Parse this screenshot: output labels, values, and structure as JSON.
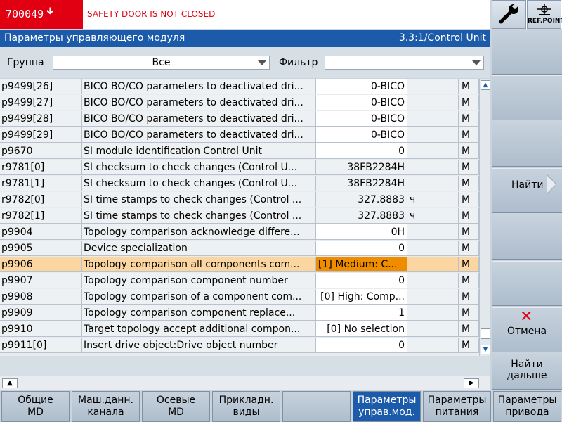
{
  "alarm": {
    "code": "700049",
    "message": "SAFETY DOOR IS NOT CLOSED"
  },
  "title": {
    "left": "Параметры управляющего модуля",
    "right": "3.3:1/Control Unit"
  },
  "filter": {
    "group_label": "Группа",
    "group_value": "Все",
    "filter_label": "Фильтр",
    "filter_value": ""
  },
  "rows": [
    {
      "param": "p9499[26]",
      "desc": "BICO BO/CO parameters to deactivated dri...",
      "value": "0-BICO",
      "unit": "",
      "mode": "M"
    },
    {
      "param": "p9499[27]",
      "desc": "BICO BO/CO parameters to deactivated dri...",
      "value": "0-BICO",
      "unit": "",
      "mode": "M"
    },
    {
      "param": "p9499[28]",
      "desc": "BICO BO/CO parameters to deactivated dri...",
      "value": "0-BICO",
      "unit": "",
      "mode": "M"
    },
    {
      "param": "p9499[29]",
      "desc": "BICO BO/CO parameters to deactivated dri...",
      "value": "0-BICO",
      "unit": "",
      "mode": "M"
    },
    {
      "param": "p9670",
      "desc": "SI module identification Control Unit",
      "value": "0",
      "unit": "",
      "mode": "M"
    },
    {
      "param": "r9781[0]",
      "desc": "SI checksum to check changes (Control U...",
      "value": "38FB2284H",
      "unit": "",
      "mode": "M"
    },
    {
      "param": "r9781[1]",
      "desc": "SI checksum to check changes (Control U...",
      "value": "38FB2284H",
      "unit": "",
      "mode": "M"
    },
    {
      "param": "r9782[0]",
      "desc": "SI time stamps to check changes (Control ...",
      "value": "327.8883",
      "unit": "ч",
      "mode": "M"
    },
    {
      "param": "r9782[1]",
      "desc": "SI time stamps to check changes (Control ...",
      "value": "327.8883",
      "unit": "ч",
      "mode": "M"
    },
    {
      "param": "p9904",
      "desc": "Topology comparison acknowledge differe...",
      "value": "0H",
      "unit": "",
      "mode": "M"
    },
    {
      "param": "p9905",
      "desc": "Device specialization",
      "value": "0",
      "unit": "",
      "mode": "M"
    },
    {
      "param": "p9906",
      "desc": "Topology comparison all components com...",
      "value": "[1] Medium: C...",
      "unit": "",
      "mode": "M"
    },
    {
      "param": "p9907",
      "desc": "Topology comparison component number",
      "value": "0",
      "unit": "",
      "mode": "M"
    },
    {
      "param": "p9908",
      "desc": "Topology comparison of a component com...",
      "value": "[0] High: Comp...",
      "unit": "",
      "mode": "M"
    },
    {
      "param": "p9909",
      "desc": "Topology comparison component replace...",
      "value": "1",
      "unit": "",
      "mode": "M"
    },
    {
      "param": "p9910",
      "desc": "Target topology accept additional compon...",
      "value": "[0] No selection",
      "unit": "",
      "mode": "M"
    },
    {
      "param": "p9911[0]",
      "desc": "Insert drive object:Drive object number",
      "value": "0",
      "unit": "",
      "mode": "M"
    }
  ],
  "right_softkeys": {
    "ref_point": "REF.POINT",
    "search": "Найти",
    "cancel": "Отмена",
    "find_next_line1": "Найти",
    "find_next_line2": "дальше"
  },
  "bottom_softkeys": [
    {
      "line1": "Общие",
      "line2": "MD"
    },
    {
      "line1": "Маш.данн.",
      "line2": "канала"
    },
    {
      "line1": "Осевые",
      "line2": "MD"
    },
    {
      "line1": "Прикладн.",
      "line2": "виды"
    },
    {
      "line1": "",
      "line2": ""
    },
    {
      "line1": "Параметры",
      "line2": "управ.мод."
    },
    {
      "line1": "Параметры",
      "line2": "питания"
    },
    {
      "line1": "Параметры",
      "line2": "привода"
    }
  ],
  "colors": {
    "alarm_red": "#e10012",
    "title_blue": "#1b5ba9",
    "selection_orange": "#f08c00",
    "selection_row": "#fcd6a0"
  },
  "icons": [
    "wrench-icon",
    "ref-point-icon",
    "search-arrow-icon",
    "cancel-x-icon"
  ]
}
